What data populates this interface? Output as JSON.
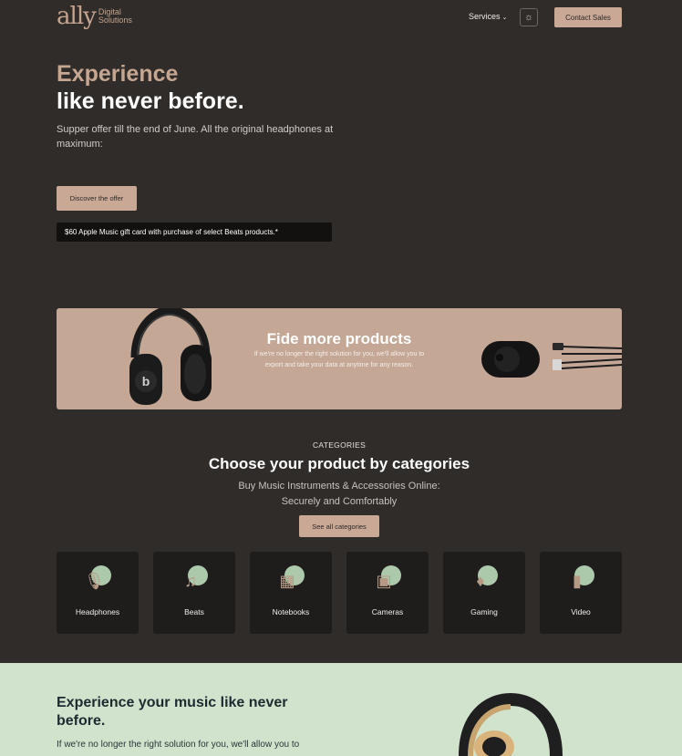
{
  "header": {
    "logo_mark": "ally",
    "logo_line1": "Digital",
    "logo_line2": "Solutions",
    "services_label": "Services",
    "theme_icon": "sun-icon",
    "contact_label": "Contact Sales"
  },
  "hero": {
    "accent": "Experience",
    "title": "like never before.",
    "subtitle": "Supper offer till the end of June. All the original headphones at maximum:",
    "cta_label": "Discover the offer",
    "gift_text": "$60 Apple Music gift card with purchase of select Beats products.*"
  },
  "banner": {
    "title": "Fide more products",
    "text": "If we're no longer the right solution for you, we'll allow you to export and take your data at anytime for any reason."
  },
  "categories": {
    "eyebrow": "CATEGORIES",
    "title": "Choose your product by categories",
    "subtitle_line1": "Buy Music Instruments & Accessories Online:",
    "subtitle_line2": "Securely and Comfortably",
    "cta_label": "See all categories",
    "items": [
      {
        "label": "Headphones",
        "icon": "microphone-icon"
      },
      {
        "label": "Beats",
        "icon": "music-note-icon"
      },
      {
        "label": "Notebooks",
        "icon": "laptop-icon"
      },
      {
        "label": "Cameras",
        "icon": "camera-icon"
      },
      {
        "label": "Gaming",
        "icon": "gamepad-icon"
      },
      {
        "label": "Video",
        "icon": "video-icon"
      }
    ]
  },
  "bottom": {
    "title": "Experience your music like never before.",
    "text": "If we're no longer the right solution for you, we'll allow you to"
  },
  "colors": {
    "background": "#2f2c2a",
    "accent": "#c9a996",
    "card": "#1e1d1c",
    "mint": "#d1e3cd"
  }
}
